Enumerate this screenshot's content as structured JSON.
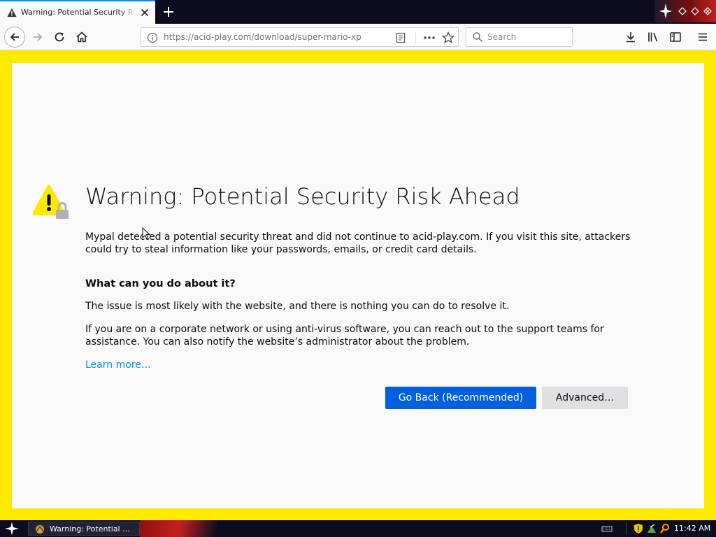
{
  "tab": {
    "title": "Warning: Potential Security Risk Ahead"
  },
  "toolbar": {
    "url": "https://acid-play.com/download/super-mario-xp",
    "search_placeholder": "Search"
  },
  "error_page": {
    "title": "Warning: Potential Security Risk Ahead",
    "description": "Mypal detected a potential security threat and did not continue to acid-play.com. If you visit this site, attackers could try to steal information like your passwords, emails, or credit card details.",
    "heading": "What can you do about it?",
    "issue_text": "The issue is most likely with the website, and there is nothing you can do to resolve it.",
    "corporate_text": "If you are on a corporate network or using anti-virus software, you can reach out to the support teams for assistance. You can also notify the website’s administrator about the problem.",
    "learn_more": "Learn more…",
    "go_back_label": "Go Back (Recommended)",
    "advanced_label": "Advanced…"
  },
  "taskbar": {
    "task_label": "Warning: Potential ...",
    "clock": "11:42 AM"
  },
  "colors": {
    "warning_border": "#ffe900",
    "primary_button": "#0060df",
    "link": "#0a8dff"
  }
}
